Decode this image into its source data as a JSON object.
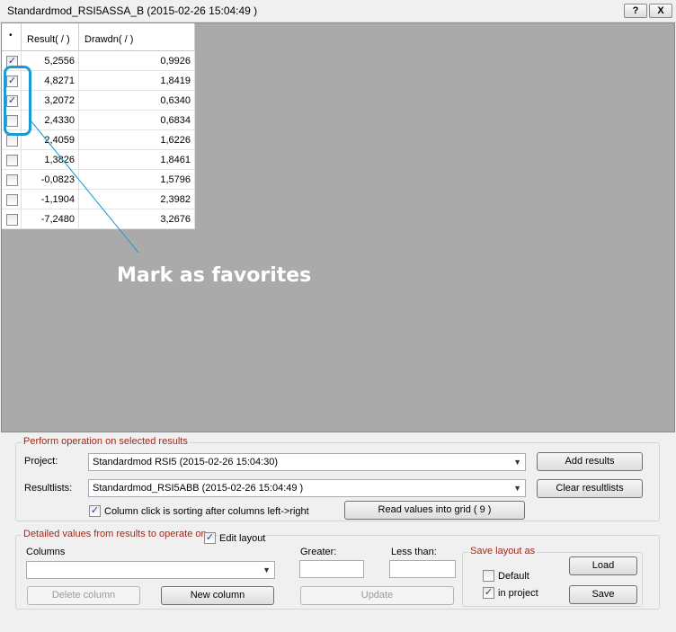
{
  "window": {
    "title": "Standardmod_RSI5ASSA_B  (2015-02-26 15:04:49 )",
    "help_label": "?",
    "close_label": "X"
  },
  "grid": {
    "columns": {
      "check": "•",
      "result": "Result( / )",
      "drawdn": "Drawdn( / )",
      "sort_indicator": "▿"
    },
    "rows": [
      {
        "checked": true,
        "result": "5,2556",
        "drawdn": "0,9926"
      },
      {
        "checked": true,
        "result": "4,8271",
        "drawdn": "1,8419"
      },
      {
        "checked": true,
        "result": "3,2072",
        "drawdn": "0,6340"
      },
      {
        "checked": false,
        "result": "2,4330",
        "drawdn": "0,6834"
      },
      {
        "checked": false,
        "result": "2,4059",
        "drawdn": "1,6226"
      },
      {
        "checked": false,
        "result": "1,3826",
        "drawdn": "1,8461"
      },
      {
        "checked": false,
        "result": "-0,0823",
        "drawdn": "1,5796"
      },
      {
        "checked": false,
        "result": "-1,1904",
        "drawdn": "2,3982"
      },
      {
        "checked": false,
        "result": "-7,2480",
        "drawdn": "3,2676"
      }
    ]
  },
  "annotation": {
    "text": "Mark as favorites",
    "color": "#1a9ad6"
  },
  "operation": {
    "title": "Perform operation on selected results",
    "project_label": "Project:",
    "project_value": "Standardmod RSI5  (2015-02-26 15:04:30)",
    "resultlists_label": "Resultlists:",
    "resultlists_value": "Standardmod_RSI5ABB  (2015-02-26 15:04:49 )",
    "add_results": "Add results",
    "clear_resultlists": "Clear resultlists",
    "sorting_label": "Column click is sorting after columns left->right",
    "sorting_checked": true,
    "read_values": "Read values into grid ( 9 )"
  },
  "detail": {
    "title": "Detailed values from results to operate on",
    "edit_layout_label": "Edit layout",
    "edit_layout_checked": true,
    "columns_label": "Columns",
    "columns_value": "",
    "greater_label": "Greater:",
    "less_label": "Less than:",
    "delete_column": "Delete column",
    "new_column": "New column",
    "update": "Update"
  },
  "save_layout": {
    "title": "Save layout as",
    "default_label": "Default",
    "default_checked": false,
    "in_project_label": "in project",
    "in_project_checked": true,
    "load": "Load",
    "save": "Save"
  },
  "icons": {
    "help": "help-icon",
    "close": "close-icon",
    "dropdown": "chevron-down-icon",
    "checkmark": "check-icon"
  },
  "colors": {
    "group_title": "#a0291c",
    "annotation": "#1a9ad6",
    "workspace": "#aaaaaa"
  }
}
